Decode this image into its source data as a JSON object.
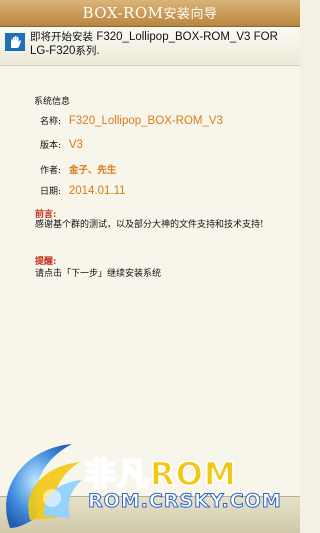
{
  "header": {
    "title_main": "BOX-ROM",
    "title_sub": "安装向导"
  },
  "topbar": {
    "icon": "hand-icon",
    "line1_prefix": "即将开始安装 ",
    "line1_rom": "F320_Lollipop_BOX-ROM_V3",
    "line1_suffix": " FOR",
    "line2_model": "LG-F320",
    "line2_suffix": "系列."
  },
  "system_info": {
    "title": "系统信息",
    "name_label": "名称:",
    "name_value": "F320_Lollipop_BOX-ROM_V3",
    "version_label": "版本:",
    "version_value": "V3",
    "author_label": "作者:",
    "author_value": "金子、先生",
    "date_label": "日期:",
    "date_value": "2014.01.11"
  },
  "preface": {
    "title": "前言:",
    "body": "感谢基个群的测试，以及部分大神的文件支持和技术支持!"
  },
  "tip": {
    "title": "提醒:",
    "body": "请点击「下一步」继续安装系统"
  },
  "watermark": {
    "brand_left": "非凡",
    "brand_right": "ROM",
    "domain": "ROM.CRSKY.COM"
  },
  "colors": {
    "header_gold": "#c99a55",
    "value_orange": "#d97a1a",
    "label_red": "#c0301b",
    "brand_blue": "#2d67c7",
    "brand_yellow": "#f2c812"
  }
}
